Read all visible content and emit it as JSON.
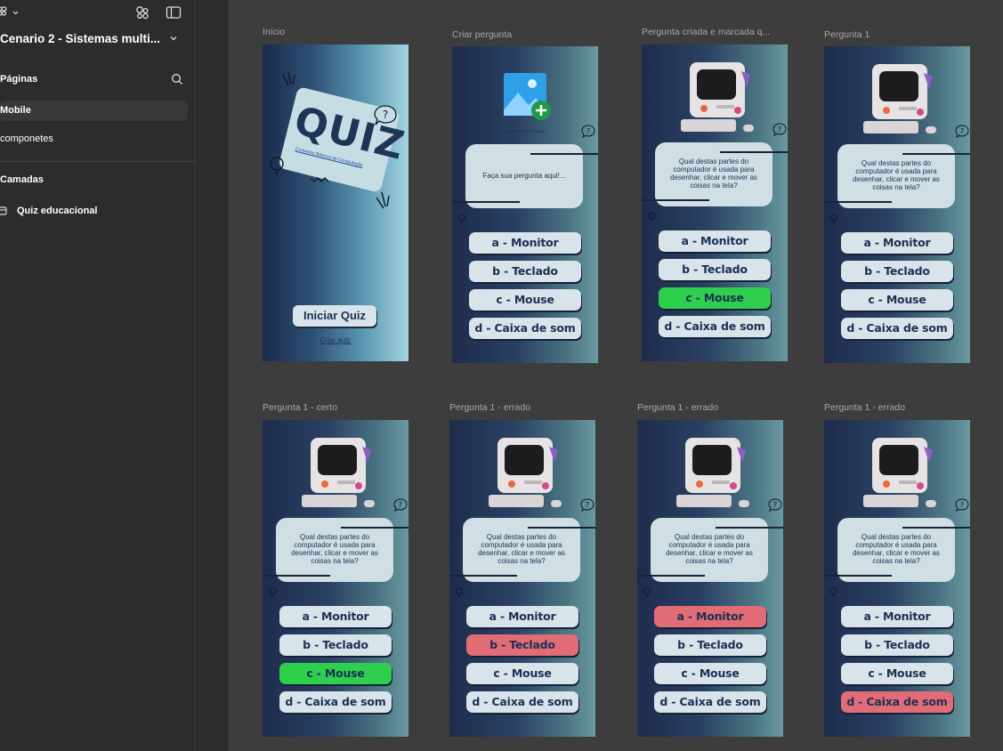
{
  "sidebar": {
    "file_title": "Cenario 2 - Sistemas multi...",
    "pages_label": "Páginas",
    "pages": [
      {
        "label": "Mobile",
        "active": true
      },
      {
        "label": "componetes",
        "active": false
      }
    ],
    "layers_label": "Camadas",
    "layers": [
      {
        "label": "Quiz educacional"
      }
    ]
  },
  "quiz": {
    "title": "QUIZ",
    "subtitle": "Conceitos Básicos de Computação",
    "start_button": "Iniciar Quiz",
    "create_link": "Criar quiz"
  },
  "create": {
    "image_caption": "Adicione uma imagem",
    "question_placeholder": "Faça sua pergunta aqui!..."
  },
  "question": "Qual destas partes do computador é usada para desenhar, clicar e mover as coisas na tela?",
  "options": [
    "a - Monitor",
    "b - Teclado",
    "c - Mouse",
    "d - Caixa de som"
  ],
  "frames": [
    {
      "label": "Início"
    },
    {
      "label": "Criar pergunta"
    },
    {
      "label": "Pergunta criada e marcada q..."
    },
    {
      "label": "Pergunta 1"
    },
    {
      "label": "Pergunta 1 - certo"
    },
    {
      "label": "Pergunta 1 - errado"
    },
    {
      "label": "Pergunta 1 - errado"
    },
    {
      "label": "Pergunta 1 - errado"
    }
  ],
  "colors": {
    "correct": "#2fcf4e",
    "wrong": "#e26c75",
    "option": "#d9e3ea",
    "text_dark": "#1c2f55"
  }
}
